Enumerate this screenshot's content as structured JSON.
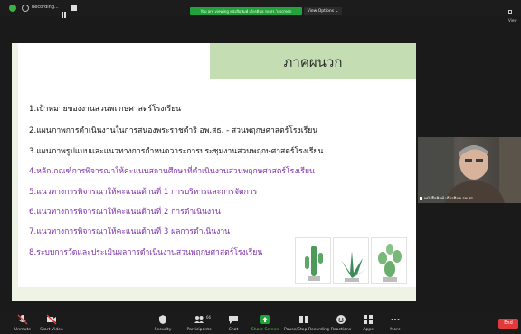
{
  "topbar": {
    "recording_label": "Recording...",
    "share_banner": "You are viewing หนังสือพิมพ์ เกียรตินย รห.สร.'s screen",
    "view_options": "View Options ⌄",
    "view_right": "View"
  },
  "slide": {
    "title": "ภาคผนวก",
    "items": [
      {
        "text": "1.เป้าหมายของงานสวนพฤกษศาสตร์โรงเรียน",
        "color": "#111111"
      },
      {
        "text": "2.แผนภาพการดำเนินงานในการสนองพระราชดำริ อพ.สธ. - สวนพฤกษศาสตร์โรงเรียน",
        "color": "#111111"
      },
      {
        "text": "3.แผนภาพรูปแบบและแนวทางการกำหนดวาระการประชุมงานสวนพฤกษศาสตร์โรงเรียน",
        "color": "#111111"
      },
      {
        "text": "4.หลักเกณฑ์การพิจารณาให้คะแนนสถานศึกษาที่ดำเนินงานสวนพฤกษศาสตร์โรงเรียน",
        "color": "#7a2ea6"
      },
      {
        "text": "5.แนวทางการพิจารณาให้คะแนนด้านที่ 1 การบริหารและการจัดการ",
        "color": "#7a2ea6"
      },
      {
        "text": "6.แนวทางการพิจารณาให้คะแนนด้านที่ 2 การดำเนินงาน",
        "color": "#7a2ea6"
      },
      {
        "text": "7.แนวทางการพิจารณาให้คะแนนด้านที่ 3 ผลการดำเนินงาน",
        "color": "#7a2ea6"
      },
      {
        "text": "8.ระบบการวัดและประเมินผลการดำเนินงานสวนพฤกษศาสตร์โรงเรียน",
        "color": "#7a2ea6"
      }
    ]
  },
  "video": {
    "participant_name": "หนังสือพิมพ์ เกียรตินย รห.สร."
  },
  "toolbar": {
    "unmute": "Unmute",
    "start_video": "Start Video",
    "security": "Security",
    "participants": "Participants",
    "participants_count": "66",
    "chat": "Chat",
    "share_screen": "Share Screen",
    "pause_stop_recording": "Pause/Stop Recording",
    "reactions": "Reactions",
    "apps": "Apps",
    "more": "More",
    "end": "End"
  },
  "colors": {
    "accent_green": "#23a23b",
    "slide_header": "#c5ddb3",
    "purple_text": "#7a2ea6",
    "end_red": "#e23a3a"
  }
}
